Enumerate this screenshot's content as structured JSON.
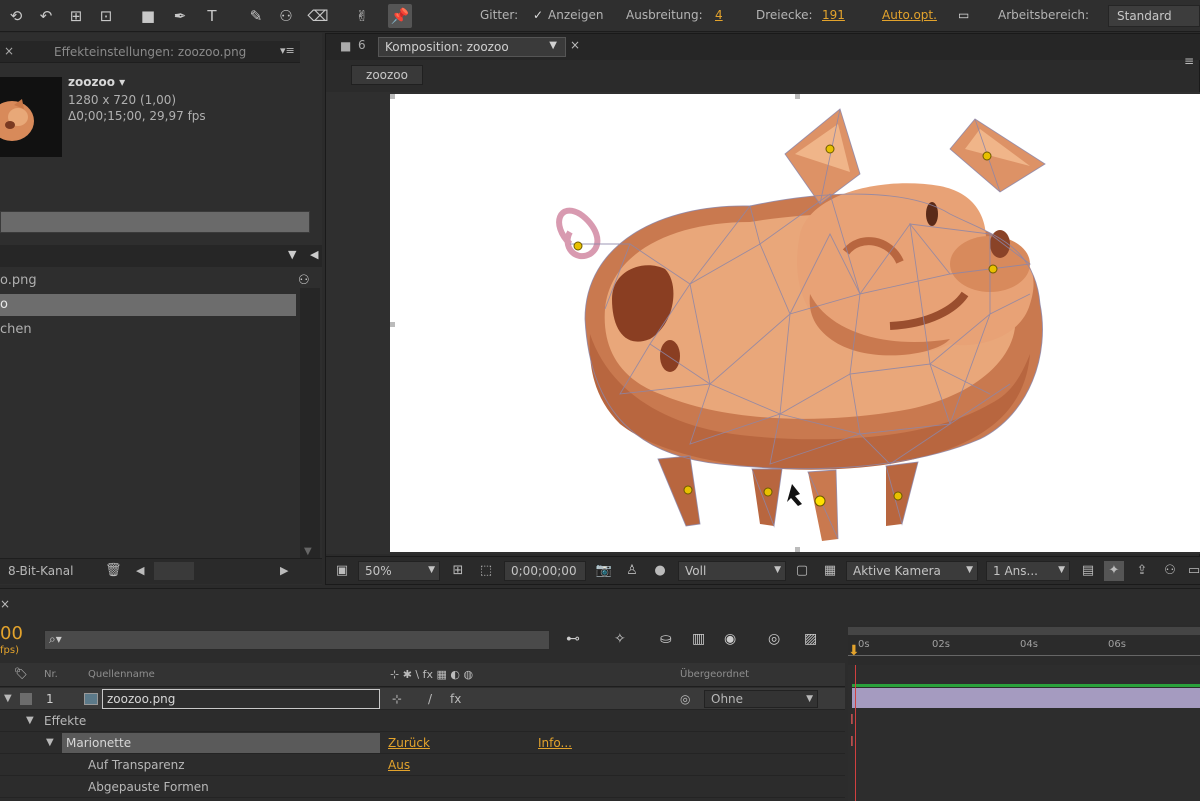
{
  "toolbar": {
    "grid_label": "Gitter:",
    "grid_show": "Anzeigen",
    "spread_label": "Ausbreitung:",
    "spread_value": "4",
    "triangles_label": "Dreiecke:",
    "triangles_value": "191",
    "auto_opt": "Auto.opt.",
    "workspace_label": "Arbeitsbereich:",
    "workspace_value": "Standard"
  },
  "effects_panel": {
    "tab_title": "Effekteinstellungen: zoozoo.png",
    "comp_name": "zoozoo ▾",
    "resolution": "1280 x 720 (1,00)",
    "duration": "Δ0;00;15;00, 29,97 fps"
  },
  "project_panel": {
    "items": [
      {
        "label": "o.png"
      },
      {
        "label": "o"
      },
      {
        "label": "chen"
      }
    ],
    "footer_bitdepth": "8-Bit-Kanal"
  },
  "composition": {
    "tab_title": "Komposition: zoozoo",
    "chip": "zoozoo",
    "zoom": "50%",
    "timecode": "0;00;00;00",
    "quality": "Voll",
    "camera": "Aktive Kamera",
    "views": "1 Ans..."
  },
  "timeline": {
    "current_time": "00",
    "fps_hint": "fps)",
    "columns": {
      "nr": "Nr.",
      "source_name": "Quellenname",
      "switches": "⊹ ✱ \\ fx ▦ ◐ ◍",
      "parent": "Übergeordnet"
    },
    "layer": {
      "index": "1",
      "name": "zoozoo.png",
      "parent": "Ohne"
    },
    "effects_label": "Effekte",
    "puppet_label": "Marionette",
    "reset_label": "Zurück",
    "info_label": "Info...",
    "transparency_label": "Auf Transparenz",
    "transparency_value": "Aus",
    "traced_label": "Abgepauste Formen",
    "ruler_labels": [
      "0s",
      "02s",
      "04s",
      "06s"
    ]
  },
  "colors": {
    "accent": "#e3a32c",
    "panel_bg": "#2b2b2b",
    "selection": "#6d6d6d",
    "layer_bar": "#a59bc0",
    "work_area": "#2aa13b"
  }
}
